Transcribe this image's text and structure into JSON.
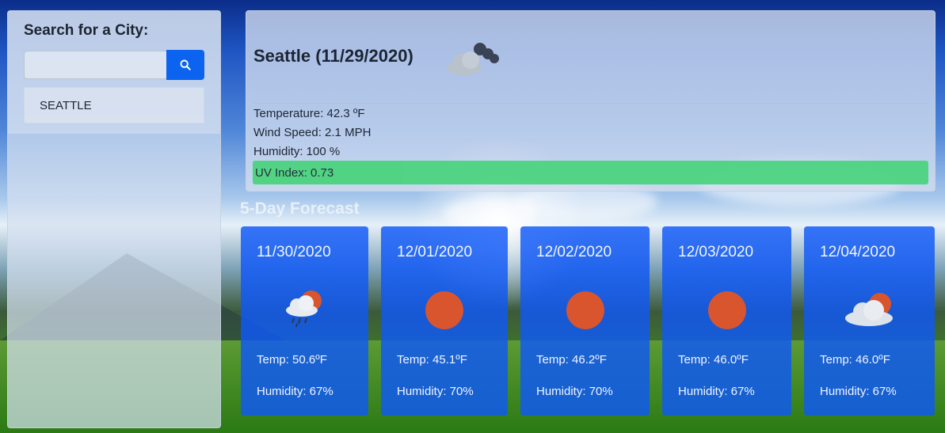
{
  "sidebar": {
    "heading": "Search for a City:",
    "search": {
      "value": "",
      "placeholder": "",
      "button_icon": "search-icon"
    },
    "history": [
      "SEATTLE"
    ]
  },
  "current": {
    "title": "Seattle (11/29/2020)",
    "icon": "cloudy-night-icon",
    "temperature": "Temperature: 42.3 ºF",
    "wind": "Wind Speed: 2.1 MPH",
    "humidity": "Humidity: 100 %",
    "uv": "UV Index: 0.73",
    "uv_color": "#4cd37f"
  },
  "forecast": {
    "heading": "5-Day Forecast",
    "days": [
      {
        "date": "11/30/2020",
        "icon": "rain-sun-icon",
        "temp": "Temp: 50.6ºF",
        "humidity": "Humidity: 67%"
      },
      {
        "date": "12/01/2020",
        "icon": "sun-icon",
        "temp": "Temp: 45.1ºF",
        "humidity": "Humidity: 70%"
      },
      {
        "date": "12/02/2020",
        "icon": "sun-icon",
        "temp": "Temp: 46.2ºF",
        "humidity": "Humidity: 70%"
      },
      {
        "date": "12/03/2020",
        "icon": "sun-icon",
        "temp": "Temp: 46.0ºF",
        "humidity": "Humidity: 67%"
      },
      {
        "date": "12/04/2020",
        "icon": "cloud-sun-icon",
        "temp": "Temp: 46.0ºF",
        "humidity": "Humidity: 67%"
      }
    ]
  },
  "colors": {
    "card_blue": "#0f58f8",
    "button_blue": "#0b63f0",
    "sun_red": "#d9552e"
  }
}
